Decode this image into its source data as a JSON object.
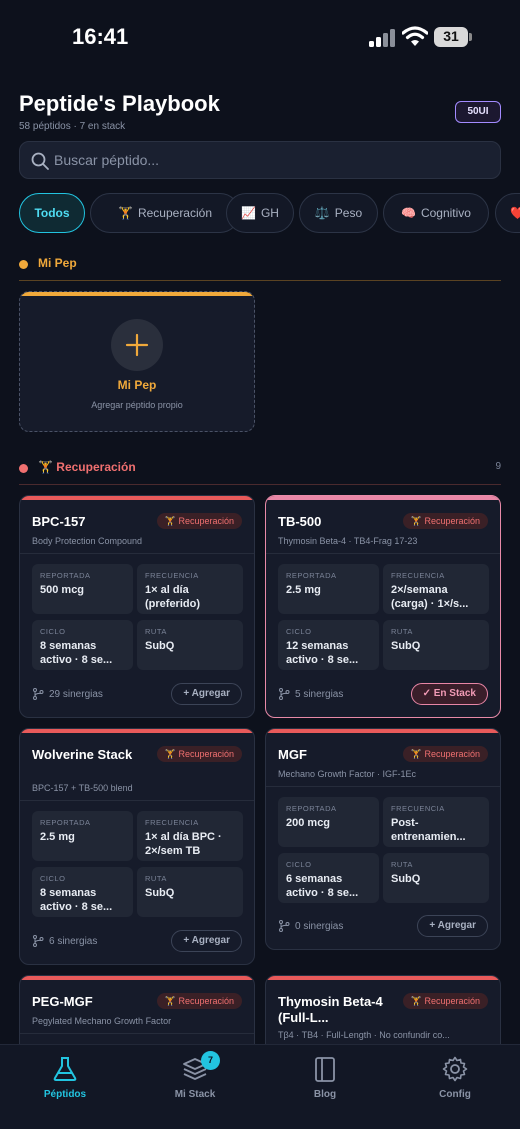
{
  "status_bar": {
    "time": "16:41",
    "battery": "31"
  },
  "header": {
    "title": "Peptide's Playbook",
    "subtitle": "58 péptidos · 7 en stack",
    "badge": "50UI"
  },
  "search": {
    "placeholder": "Buscar péptido..."
  },
  "filters": [
    {
      "label": "Todos",
      "emoji": "",
      "active": true
    },
    {
      "label": "Recuperación",
      "emoji": "🏋",
      "active": false
    },
    {
      "label": "GH",
      "emoji": "📈",
      "active": false
    },
    {
      "label": "Peso",
      "emoji": "⚖️",
      "active": false
    },
    {
      "label": "Cognitivo",
      "emoji": "🧠",
      "active": false
    },
    {
      "label": "",
      "emoji": "❤️",
      "active": false
    }
  ],
  "sections": {
    "mi_pep": {
      "label": "Mi Pep",
      "color": "#f0a93b"
    },
    "recuperacion": {
      "emoji": "🏋",
      "label": "Recuperación",
      "count": "9",
      "color": "#f07070"
    }
  },
  "mi_pep_card": {
    "name": "Mi Pep",
    "description": "Agregar péptido propio"
  },
  "labels": {
    "reportada": "REPORTADA",
    "frecuencia": "FRECUENCIA",
    "ciclo": "CICLO",
    "ruta": "RUTA"
  },
  "cards": [
    {
      "title": "BPC-157",
      "tag": "🏋 Recuperación",
      "subtitle": "Body Protection Compound",
      "reportada": "500 mcg",
      "frecuencia": "1× al día (preferido)",
      "ciclo": "8 semanas activo · 8 se...",
      "ruta": "SubQ",
      "sinergias": "29 sinergias",
      "button": "+ Agregar",
      "in_stack": false
    },
    {
      "title": "TB-500",
      "tag": "🏋 Recuperación",
      "subtitle": "Thymosin Beta-4 · TB4-Frag 17-23",
      "reportada": "2.5 mg",
      "frecuencia": "2×/semana (carga) · 1×/s...",
      "ciclo": "12 semanas activo · 8 se...",
      "ruta": "SubQ",
      "sinergias": "5 sinergias",
      "button": "✓ En Stack",
      "in_stack": true
    },
    {
      "title": "Wolverine Stack",
      "tag": "🏋 Recuperación",
      "subtitle": "BPC-157 + TB-500 blend",
      "reportada": "2.5 mg",
      "frecuencia": "1× al día BPC · 2×/sem TB",
      "ciclo": "8 semanas activo · 8 se...",
      "ruta": "SubQ",
      "sinergias": "6 sinergias",
      "button": "+ Agregar",
      "in_stack": false
    },
    {
      "title": "MGF",
      "tag": "🏋 Recuperación",
      "subtitle": "Mechano Growth Factor · IGF-1Ec",
      "reportada": "200 mcg",
      "frecuencia": "Post-entrenamien...",
      "ciclo": "6 semanas activo · 8 se...",
      "ruta": "SubQ",
      "sinergias": "0 sinergias",
      "button": "+ Agregar",
      "in_stack": false
    },
    {
      "title": "PEG-MGF",
      "tag": "🏋 Recuperación",
      "subtitle": "Pegylated Mechano Growth Factor"
    },
    {
      "title": "Thymosin Beta-4 (Full-L...",
      "tag": "🏋 Recuperación",
      "subtitle": "Tβ4 · TB4 · Full-Length · No confundir co..."
    }
  ],
  "tabbar": {
    "peptidos": "Péptidos",
    "mi_stack": "Mi Stack",
    "mi_stack_badge": "7",
    "blog": "Blog",
    "config": "Config"
  }
}
